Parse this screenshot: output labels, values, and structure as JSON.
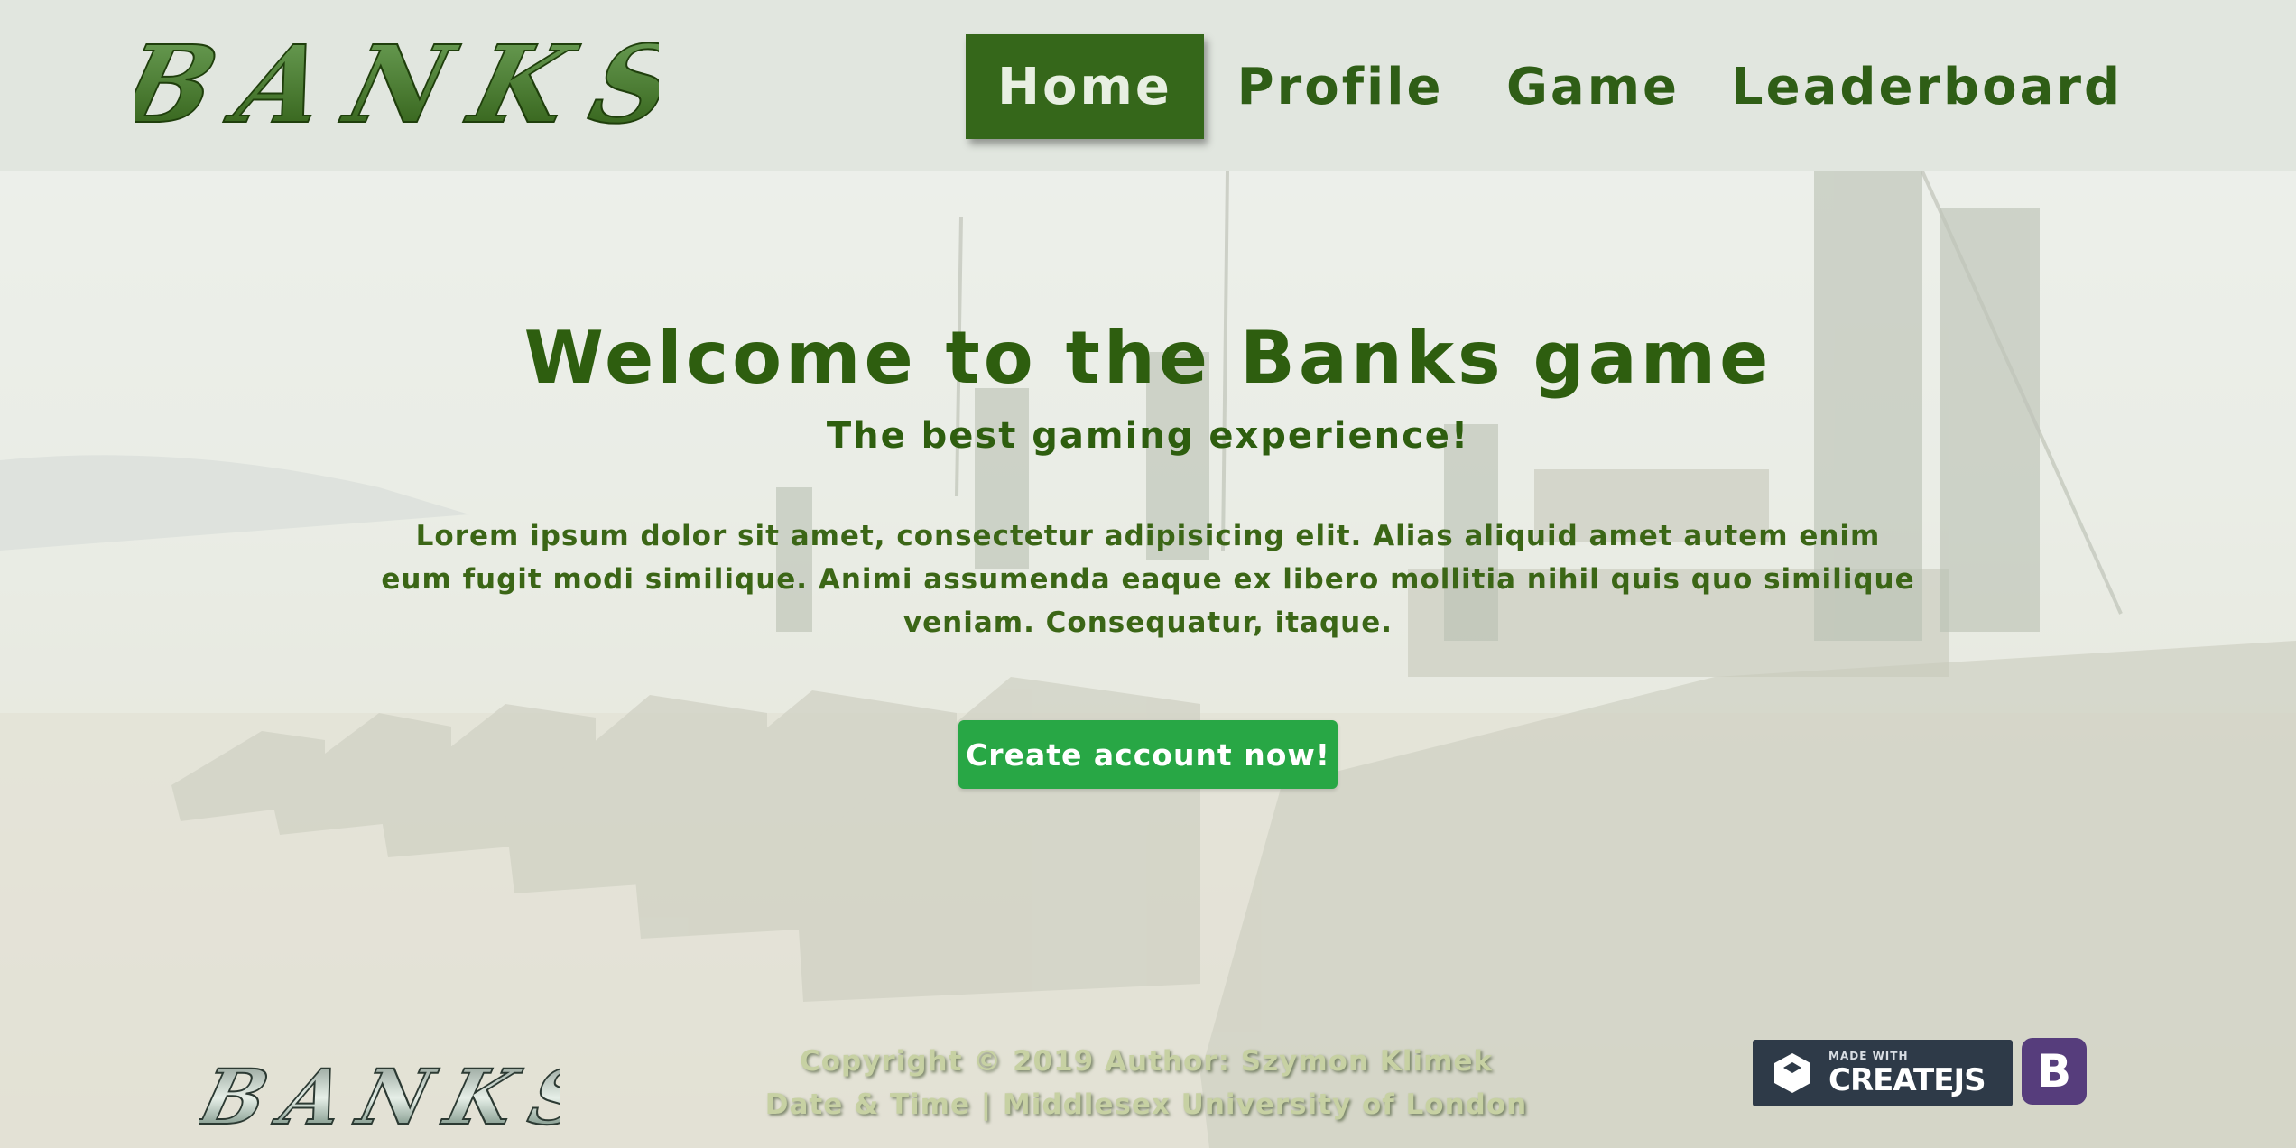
{
  "brand": {
    "logo_text": "BANKS"
  },
  "nav": {
    "items": [
      {
        "label": "Home",
        "active": true
      },
      {
        "label": "Profile",
        "active": false
      },
      {
        "label": "Game",
        "active": false
      },
      {
        "label": "Leaderboard",
        "active": false
      }
    ]
  },
  "hero": {
    "title": "Welcome to the Banks game",
    "subtitle": "The best gaming experience!",
    "text": "Lorem ipsum dolor sit amet, consectetur adipisicing elit. Alias aliquid amet autem enim eum fugit modi similique. Animi assumenda eaque ex libero mollitia nihil quis quo similique veniam. Consequatur, itaque.",
    "cta_label": "Create account now!"
  },
  "footer": {
    "logo_text": "BANKS",
    "copyright": "Copyright © 2019 Author: Szymon Klimek",
    "info": "Date & Time | Middlesex University of London",
    "createjs_made": "MADE WITH",
    "createjs_name": "CREATEJS",
    "bootstrap_letter": "B"
  },
  "colors": {
    "nav_active_bg": "#35671a",
    "nav_text": "#2f5e16",
    "title_green": "#2e5e0f",
    "cta_bg": "#28a745",
    "createjs_bg": "#2e3a48",
    "bootstrap_bg": "#563d7c"
  }
}
